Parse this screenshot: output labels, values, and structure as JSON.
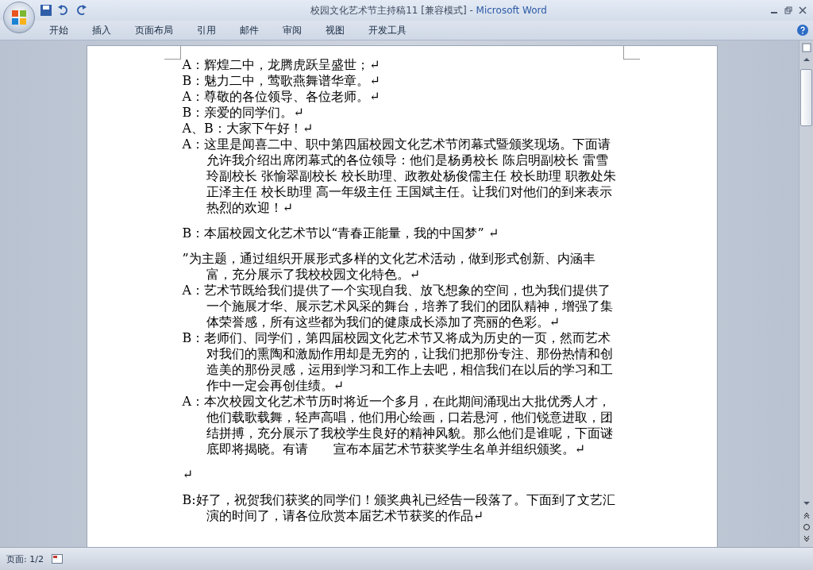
{
  "window": {
    "title": "校园文化艺术节主持稿11 [兼容模式]",
    "separator": "-",
    "app_name": "Microsoft Word"
  },
  "ribbon_tabs": [
    {
      "label": "开始",
      "selected": false
    },
    {
      "label": "插入",
      "selected": false
    },
    {
      "label": "页面布局",
      "selected": false
    },
    {
      "label": "引用",
      "selected": false
    },
    {
      "label": "邮件",
      "selected": false
    },
    {
      "label": "审阅",
      "selected": false
    },
    {
      "label": "视图",
      "selected": false
    },
    {
      "label": "开发工具",
      "selected": false
    }
  ],
  "document": {
    "paragraphs": [
      {
        "text": "A：辉煌二中，龙腾虎跃呈盛世；↵",
        "space_before": false
      },
      {
        "text": "B：魅力二中，莺歌燕舞谱华章。↵",
        "space_before": false
      },
      {
        "text": "A：尊敬的各位领导、各位老师。↵",
        "space_before": false
      },
      {
        "text": "B：亲爱的同学们。↵",
        "space_before": false
      },
      {
        "text": "A、B：大家下午好！↵",
        "space_before": false
      },
      {
        "text": "A：这里是闻喜二中、职中第四届校园文化艺术节闭幕式暨颁奖现场。下面请允许我介绍出席闭幕式的各位领导：他们是杨勇校长 陈启明副校长 雷雪玲副校长 张愉翠副校长 校长助理、政教处杨俊儒主任 校长助理 职教处朱正泽主任 校长助理 高一年级主任 王国斌主任。让我们对他们的到来表示热烈的欢迎！↵",
        "space_before": false
      },
      {
        "text": "B：本届校园文化艺术节以“青春正能量，我的中国梦” ↵",
        "space_before": true
      },
      {
        "text": "”为主题，通过组织开展形式多样的文化艺术活动，做到形式创新、内涵丰富，充分展示了我校校园文化特色。↵",
        "space_before": true
      },
      {
        "text": "A：艺术节既给我们提供了一个实现自我、放飞想象的空间，也为我们提供了一个施展才华、展示艺术风采的舞台，培养了我们的团队精神，增强了集体荣誉感，所有这些都为我们的健康成长添加了亮丽的色彩。↵",
        "space_before": false
      },
      {
        "text": "B：老师们、同学们，第四届校园文化艺术节又将成为历史的一页，然而艺术对我们的熏陶和激励作用却是无穷的，让我们把那份专注、那份热情和创造美的那份灵感，运用到学习和工作上去吧，相信我们在以后的学习和工作中一定会再创佳绩。↵",
        "space_before": false
      },
      {
        "text": "A：本次校园文化艺术节历时将近一个多月，在此期间涌现出大批优秀人才，他们载歌载舞，轻声高唱，他们用心绘画，口若悬河，他们锐意进取，团结拼搏，充分展示了我校学生良好的精神风貌。那么他们是谁呢，下面谜底即将揭晓。有请　　宣布本届艺术节获奖学生名单并组织颁奖。↵",
        "space_before": false
      },
      {
        "text": "↵",
        "space_before": true
      },
      {
        "text": "B:好了，祝贺我们获奖的同学们！颁奖典礼已经告一段落了。下面到了文艺汇演的时间了，请各位欣赏本届艺术节获奖的作品↵",
        "space_before": true
      }
    ]
  },
  "status_bar": {
    "page": "页面: 1/2"
  }
}
